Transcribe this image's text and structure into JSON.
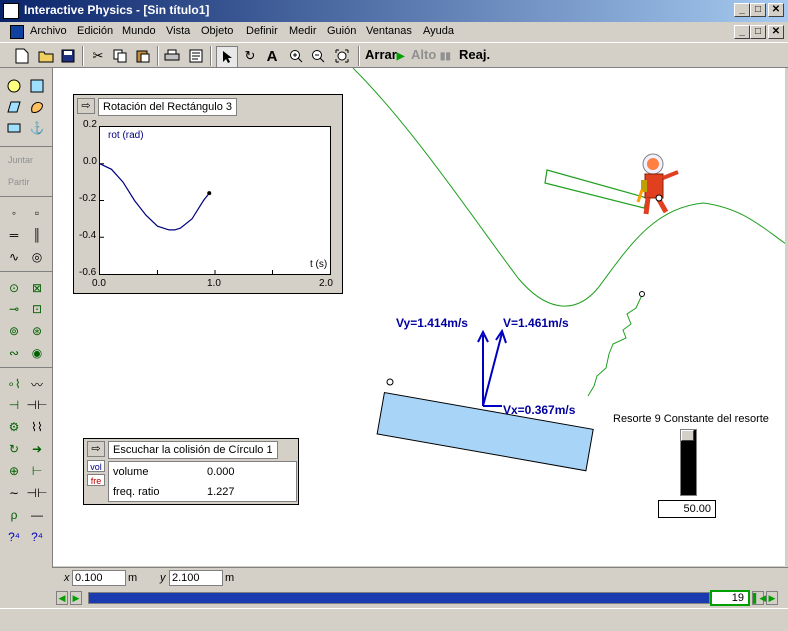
{
  "window": {
    "title": "Interactive Physics - [Sin título1]",
    "min": "_",
    "max": "□",
    "close": "✕"
  },
  "menu": [
    "Archivo",
    "Edición",
    "Mundo",
    "Vista",
    "Objeto",
    "Definir",
    "Medir",
    "Guión",
    "Ventanas",
    "Ayuda"
  ],
  "toolbar": {
    "run_label": "Arrar",
    "stop_label": "Alto",
    "reset_label": "Reaj.",
    "text_tool": "A"
  },
  "palette": {
    "join_label": "Juntar",
    "split_label": "Partir"
  },
  "graph": {
    "title": "Rotación del Rectángulo 3",
    "ylabel": "rot (rad)",
    "xlabel": "t (s)",
    "yticks": [
      "0.2",
      "0.0",
      "-0.2",
      "-0.4",
      "-0.6"
    ],
    "xticks": [
      "0.0",
      "1.0",
      "2.0"
    ]
  },
  "chart_data": {
    "type": "line",
    "title": "Rotación del Rectángulo 3",
    "xlabel": "t (s)",
    "ylabel": "rot (rad)",
    "xlim": [
      0,
      2
    ],
    "ylim": [
      -0.6,
      0.2
    ],
    "x": [
      0.0,
      0.1,
      0.2,
      0.3,
      0.4,
      0.5,
      0.6,
      0.65,
      0.7,
      0.8,
      0.9,
      0.95
    ],
    "y": [
      0.0,
      -0.03,
      -0.1,
      -0.2,
      -0.28,
      -0.34,
      -0.36,
      -0.36,
      -0.35,
      -0.3,
      -0.2,
      -0.16
    ]
  },
  "meter": {
    "title": "Escuchar la colisión de Círculo 1",
    "tags": [
      "vol",
      "fre"
    ],
    "rows": [
      {
        "label": "volume",
        "value": "0.000"
      },
      {
        "label": "freq. ratio",
        "value": "1.227"
      }
    ]
  },
  "vectors": {
    "vy": "Vy=1.414m/s",
    "v": "V=1.461m/s",
    "vx": "Vx=0.367m/s"
  },
  "slider": {
    "title": "Resorte 9 Constante del resorte",
    "value": "50.00"
  },
  "coords": {
    "x_label": "x",
    "x_value": "0.100",
    "x_unit": "m",
    "y_label": "y",
    "y_value": "2.100",
    "y_unit": "m"
  },
  "tape": {
    "frame": "19"
  }
}
